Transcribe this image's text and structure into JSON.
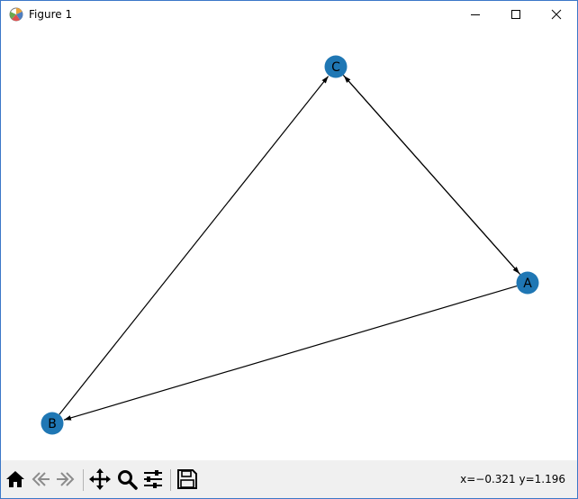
{
  "window": {
    "title": "Figure 1"
  },
  "graph": {
    "nodes": [
      {
        "id": "A",
        "label": "A"
      },
      {
        "id": "B",
        "label": "B"
      },
      {
        "id": "C",
        "label": "C"
      }
    ],
    "edges": [
      {
        "from": "A",
        "to": "B"
      },
      {
        "from": "A",
        "to": "C"
      },
      {
        "from": "B",
        "to": "C"
      },
      {
        "from": "C",
        "to": "A"
      }
    ],
    "node_color": "#1f77b4",
    "edge_color": "#000000"
  },
  "toolbar": {
    "buttons": [
      "home-icon",
      "back-icon",
      "forward-icon",
      "pan-icon",
      "zoom-icon",
      "configure-subplots-icon",
      "save-icon"
    ],
    "coords_text": "x=−0.321 y=1.196"
  }
}
